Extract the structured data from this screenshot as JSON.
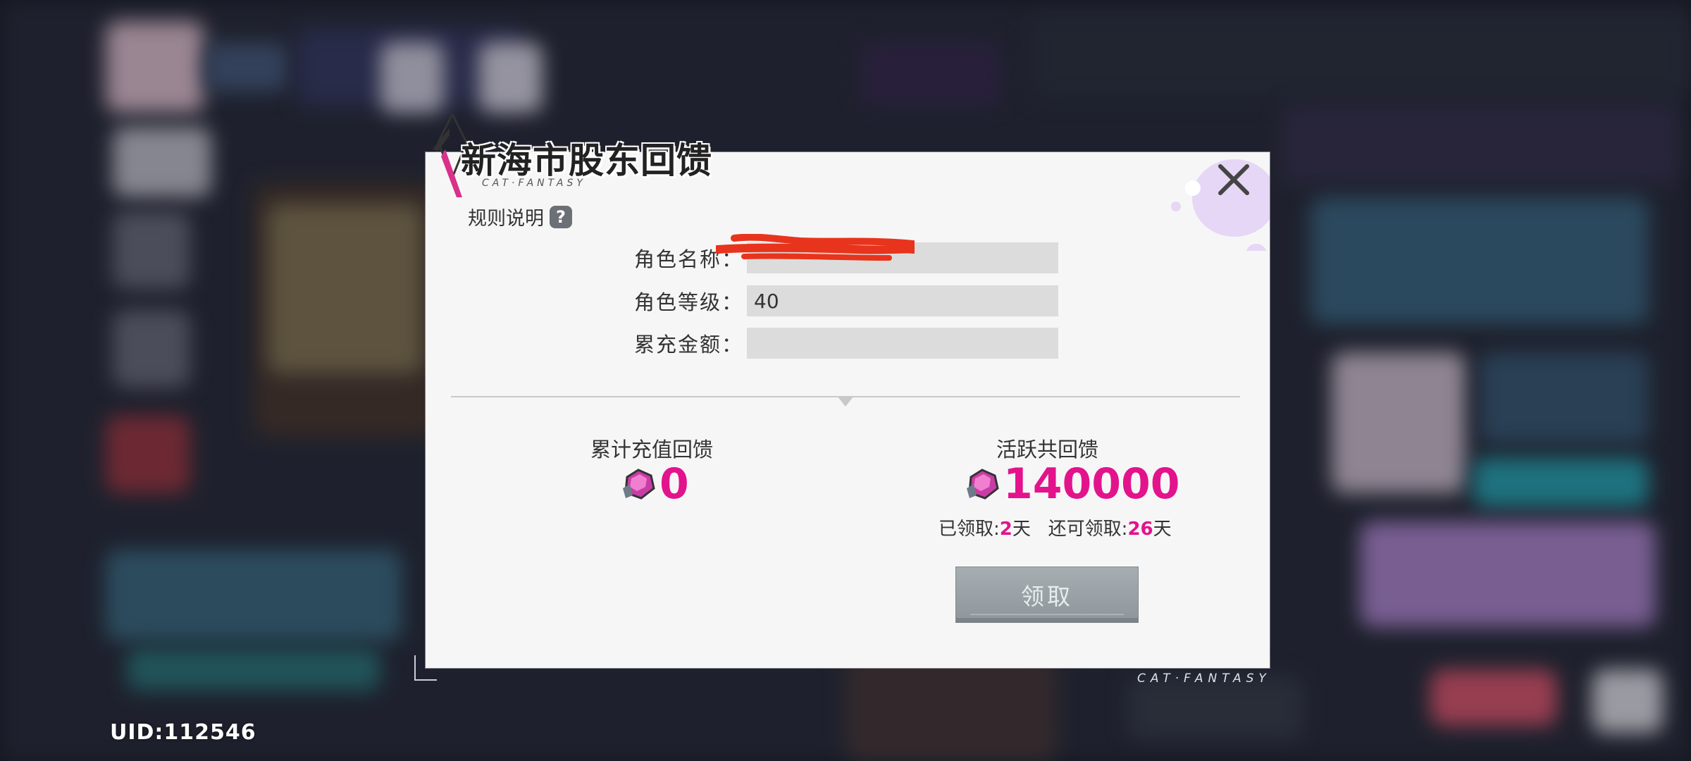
{
  "uid": "UID:112546",
  "footer_logo": "CAT·FANTASY",
  "dialog": {
    "title": "新海市股东回馈",
    "title_sub": "CAT·FANTASY",
    "rules_label": "规则说明",
    "rules_icon": "?",
    "fields": [
      {
        "label": "角色名称：",
        "value": ""
      },
      {
        "label": "角色等级：",
        "value": "40"
      },
      {
        "label": "累充金额：",
        "value": ""
      }
    ],
    "cumulative": {
      "title": "累计充值回馈",
      "value": "0"
    },
    "active": {
      "title": "活跃共回馈",
      "value": "140000"
    },
    "claim_info": {
      "claimed_label": "已领取:",
      "claimed_days": "2",
      "day_unit": "天",
      "remaining_label": "还可领取:",
      "remaining_days": "26"
    },
    "claim_button": "领取"
  },
  "colors": {
    "accent_pink": "#e3138c",
    "dialog_bg": "#f6f6f7",
    "button_grey": "#9aa2a6"
  }
}
